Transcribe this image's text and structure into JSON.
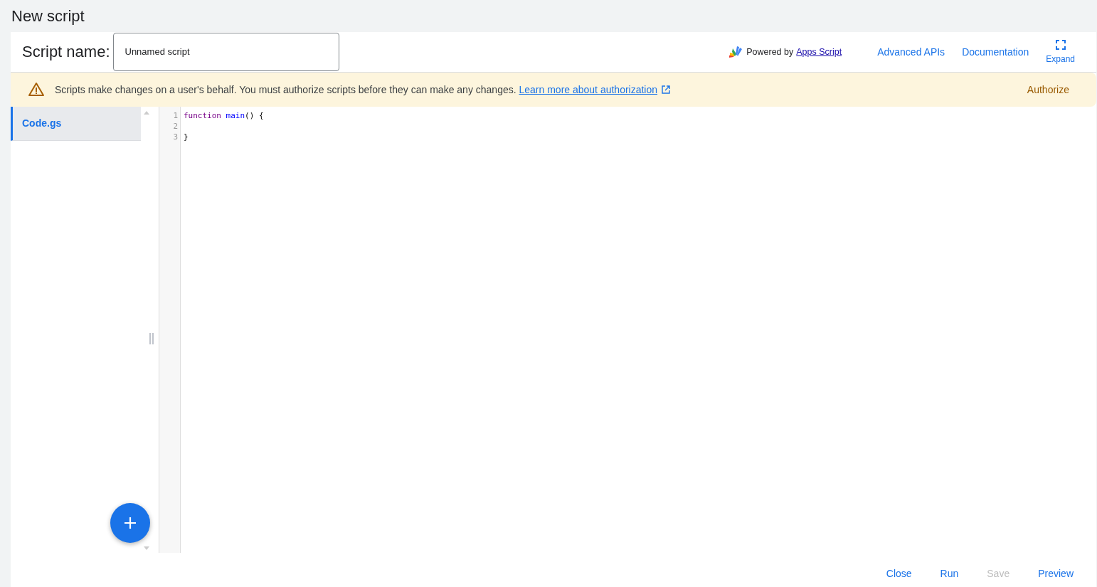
{
  "page_title": "New script",
  "header": {
    "name_label": "Script name:",
    "name_field": {
      "value": "Unnamed script"
    },
    "powered_by": "Powered by",
    "powered_link": "Apps Script",
    "links": [
      "Advanced APIs",
      "Documentation"
    ],
    "expand_label": "Expand"
  },
  "banner": {
    "message": "Scripts make changes on a user's behalf. You must authorize scripts before they can make any changes.",
    "link": "Learn more about authorization",
    "action": "Authorize"
  },
  "files": [
    {
      "name": "Code.gs",
      "selected": true
    }
  ],
  "code_lines": [
    {
      "number": "1",
      "tokens": [
        {
          "kind": "keyword",
          "text": "function"
        },
        {
          "kind": "name",
          "text": " main"
        },
        {
          "kind": "plain",
          "text": "() {"
        }
      ]
    },
    {
      "number": "2"
    },
    {
      "number": "3",
      "tokens": [
        {
          "kind": "plain",
          "text": "}"
        }
      ]
    }
  ],
  "footer_buttons": [
    {
      "label": "Close",
      "disabled": false
    },
    {
      "label": "Run",
      "disabled": false
    },
    {
      "label": "Save",
      "disabled": true
    },
    {
      "label": "Preview",
      "disabled": false
    }
  ]
}
